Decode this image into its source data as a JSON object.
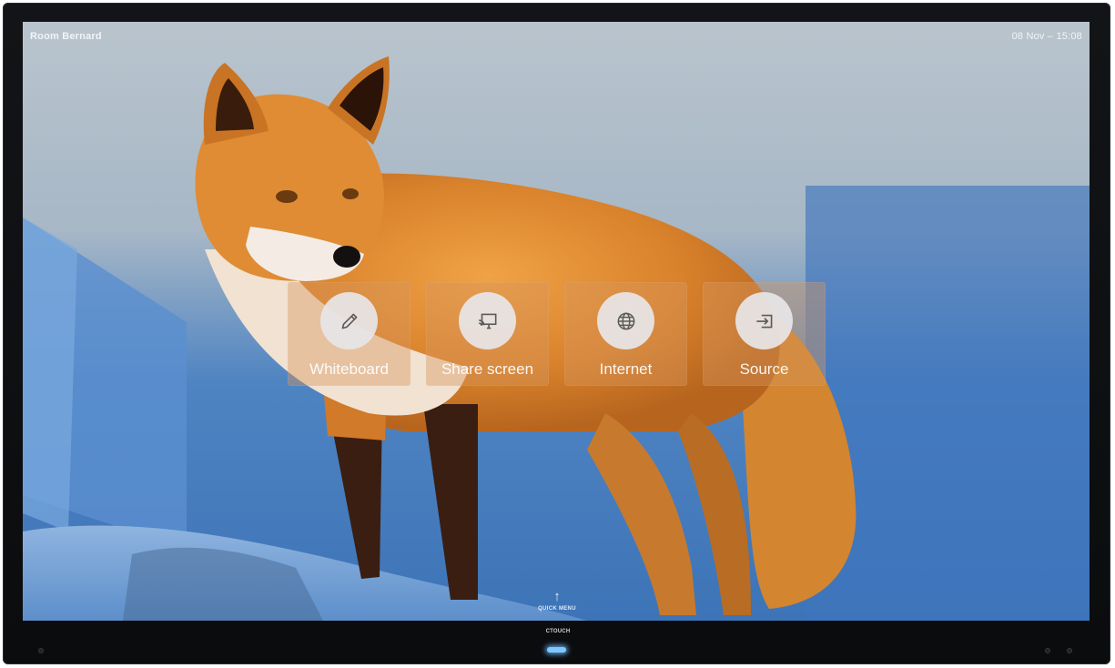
{
  "status_bar": {
    "room_name": "Room Bernard",
    "date_time": "08 Nov – 15:08"
  },
  "launcher": {
    "tiles": [
      {
        "label": "Whiteboard",
        "icon": "pencil-icon"
      },
      {
        "label": "Share screen",
        "icon": "cast-screen-icon"
      },
      {
        "label": "Internet",
        "icon": "globe-icon"
      },
      {
        "label": "Source",
        "icon": "input-source-icon"
      }
    ]
  },
  "quick_menu": {
    "arrow": "↑",
    "label": "QUICK MENU"
  },
  "device": {
    "brand": "CTOUCH"
  },
  "colors": {
    "bezel": "#0b0c0e",
    "tile_background": "#d6965c",
    "icon_circle": "#e8e6e8",
    "power_led": "#7fc8ff"
  }
}
